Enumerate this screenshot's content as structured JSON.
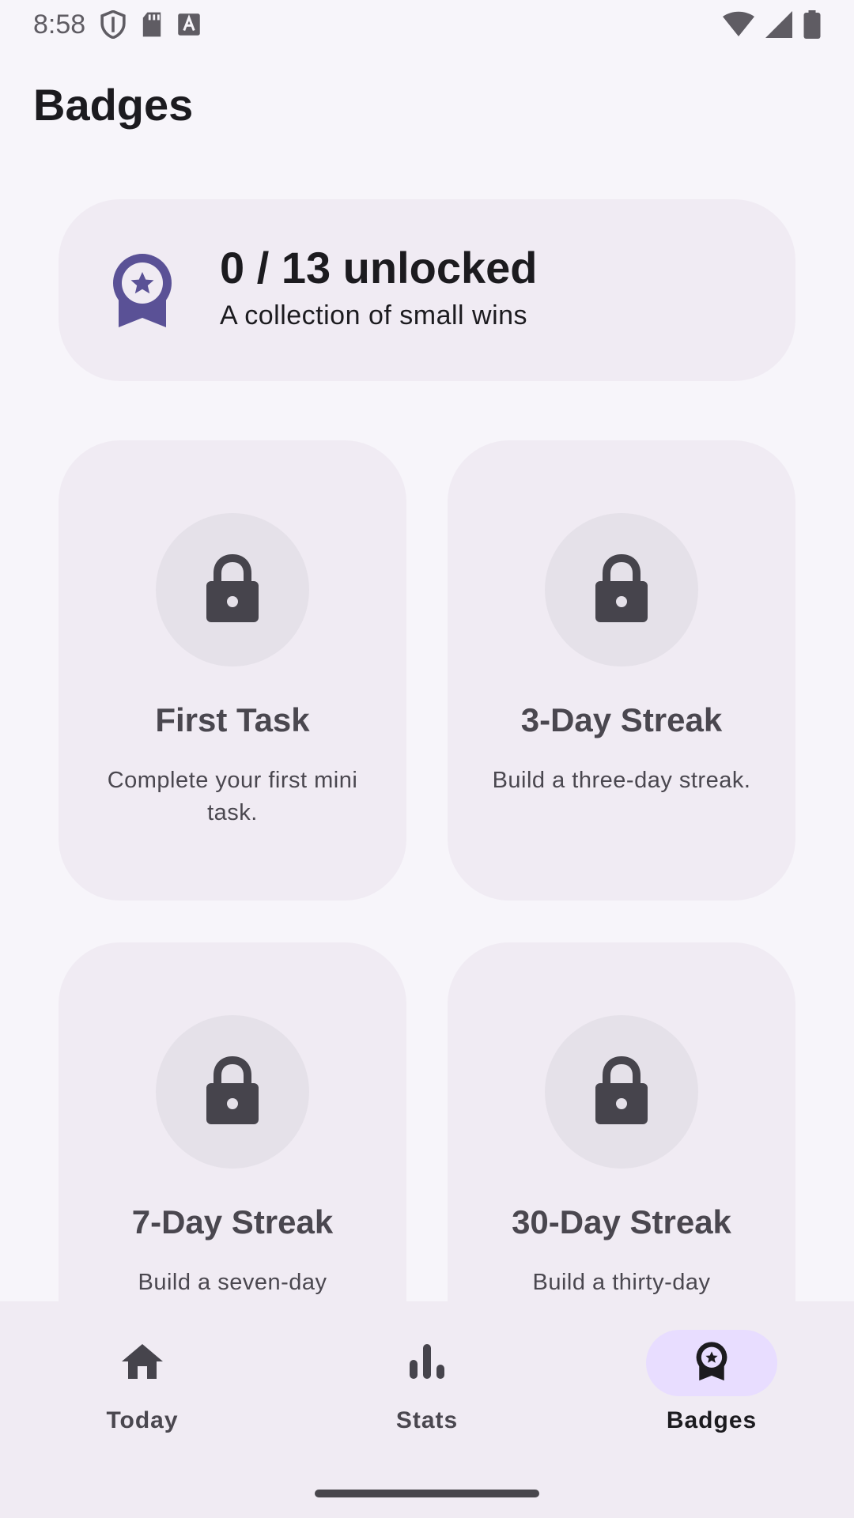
{
  "status_bar": {
    "time": "8:58",
    "left_icons": [
      "shield-icon",
      "sd-card-icon",
      "text-a-icon"
    ],
    "right_icons": [
      "wifi-icon",
      "signal-icon",
      "battery-icon"
    ]
  },
  "header": {
    "title": "Badges"
  },
  "summary": {
    "count_text": "0 / 13 unlocked",
    "subtitle": "A collection of small wins",
    "icon": "award-ribbon-icon",
    "icon_color": "#5a5196"
  },
  "badges": [
    {
      "title": "First Task",
      "description": "Complete your first mini task.",
      "icon": "lock-icon",
      "locked": true
    },
    {
      "title": "3-Day Streak",
      "description": "Build a three-day streak.",
      "icon": "lock-icon",
      "locked": true
    },
    {
      "title": "7-Day Streak",
      "description": "Build a seven-day",
      "icon": "lock-icon",
      "locked": true
    },
    {
      "title": "30-Day Streak",
      "description": "Build a thirty-day",
      "icon": "lock-icon",
      "locked": true
    }
  ],
  "bottom_nav": {
    "items": [
      {
        "label": "Today",
        "icon": "home-icon",
        "active": false
      },
      {
        "label": "Stats",
        "icon": "bar-chart-icon",
        "active": false
      },
      {
        "label": "Badges",
        "icon": "award-icon",
        "active": true
      }
    ]
  },
  "colors": {
    "background": "#f7f5fa",
    "card": "#f0ebf3",
    "lock_circle": "#e5e1e9",
    "active_pill": "#e8ddff",
    "accent": "#5a5196"
  }
}
